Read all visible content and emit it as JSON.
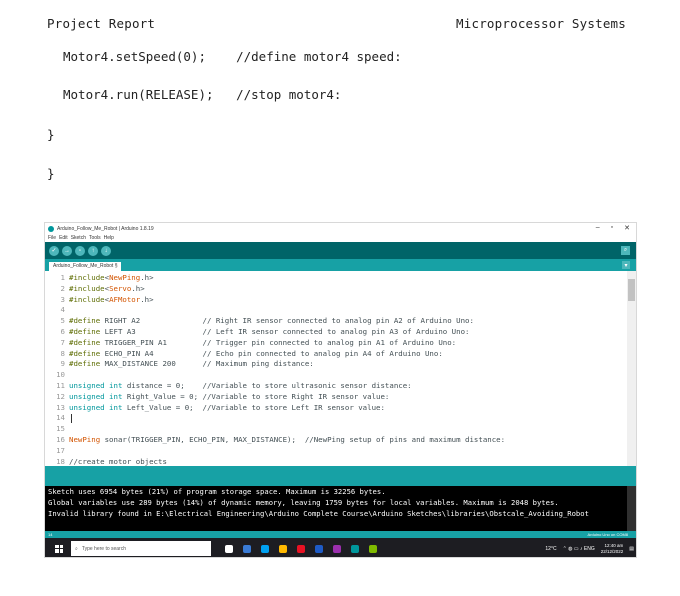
{
  "document": {
    "header_left": "Project Report",
    "header_right": "Microprocessor Systems",
    "code_lines": [
      "Motor4.setSpeed(0);    //define motor4 speed:",
      "Motor4.run(RELEASE);   //stop motor4:",
      "}",
      "}"
    ]
  },
  "window": {
    "title": "Arduino_Follow_Me_Robot | Arduino 1.8.19",
    "controls": {
      "minimize": "–",
      "maximize": "▫",
      "close": "✕"
    },
    "menu": [
      "File",
      "Edit",
      "Sketch",
      "Tools",
      "Help"
    ],
    "tab_name": "Arduino_Follow_Me_Robot §",
    "status_left": "14",
    "status_right": "Arduino Uno on COM8"
  },
  "editor_lines": [
    {
      "n": "1",
      "code": "#include<NewPing.h>"
    },
    {
      "n": "2",
      "code": "#include<Servo.h>"
    },
    {
      "n": "3",
      "code": "#include<AFMotor.h>"
    },
    {
      "n": "4",
      "code": ""
    },
    {
      "n": "5",
      "code": "#define RIGHT A2              // Right IR sensor connected to analog pin A2 of Arduino Uno:"
    },
    {
      "n": "6",
      "code": "#define LEFT A3               // Left IR sensor connected to analog pin A3 of Arduino Uno:"
    },
    {
      "n": "7",
      "code": "#define TRIGGER_PIN A1        // Trigger pin connected to analog pin A1 of Arduino Uno:"
    },
    {
      "n": "8",
      "code": "#define ECHO_PIN A4           // Echo pin connected to analog pin A4 of Arduino Uno:"
    },
    {
      "n": "9",
      "code": "#define MAX_DISTANCE 200      // Maximum ping distance:"
    },
    {
      "n": "10",
      "code": ""
    },
    {
      "n": "11",
      "code": "unsigned int distance = 0;    //Variable to store ultrasonic sensor distance:"
    },
    {
      "n": "12",
      "code": "unsigned int Right_Value = 0; //Variable to store Right IR sensor value:"
    },
    {
      "n": "13",
      "code": "unsigned int Left_Value = 0;  //Variable to store Left IR sensor value:"
    },
    {
      "n": "14",
      "code": ""
    },
    {
      "n": "15",
      "code": ""
    },
    {
      "n": "16",
      "code": "NewPing sonar(TRIGGER_PIN, ECHO_PIN, MAX_DISTANCE);  //NewPing setup of pins and maximum distance:"
    },
    {
      "n": "17",
      "code": ""
    },
    {
      "n": "18",
      "code": "//create motor objects"
    }
  ],
  "console_lines": [
    "Sketch uses 6954 bytes (21%) of program storage space. Maximum is 32256 bytes.",
    "Global variables use 289 bytes (14%) of dynamic memory, leaving 1759 bytes for local variables. Maximum is 2048 bytes.",
    "Invalid library found in E:\\Electrical Engineering\\Arduino Complete Course\\Arduino Sketches\\libraries\\Obstcale_Avoiding_Robot"
  ],
  "taskbar": {
    "search_placeholder": "Type here to search",
    "weather": "12°C",
    "time": "12:40 am",
    "date": "22/12/2022",
    "icon_colors": [
      "#ffffff",
      "#3a7bd5",
      "#00a1f1",
      "#ffb900",
      "#e81123",
      "#1e5bc6",
      "#9b2fae",
      "#00979c",
      "#7fba00"
    ]
  }
}
